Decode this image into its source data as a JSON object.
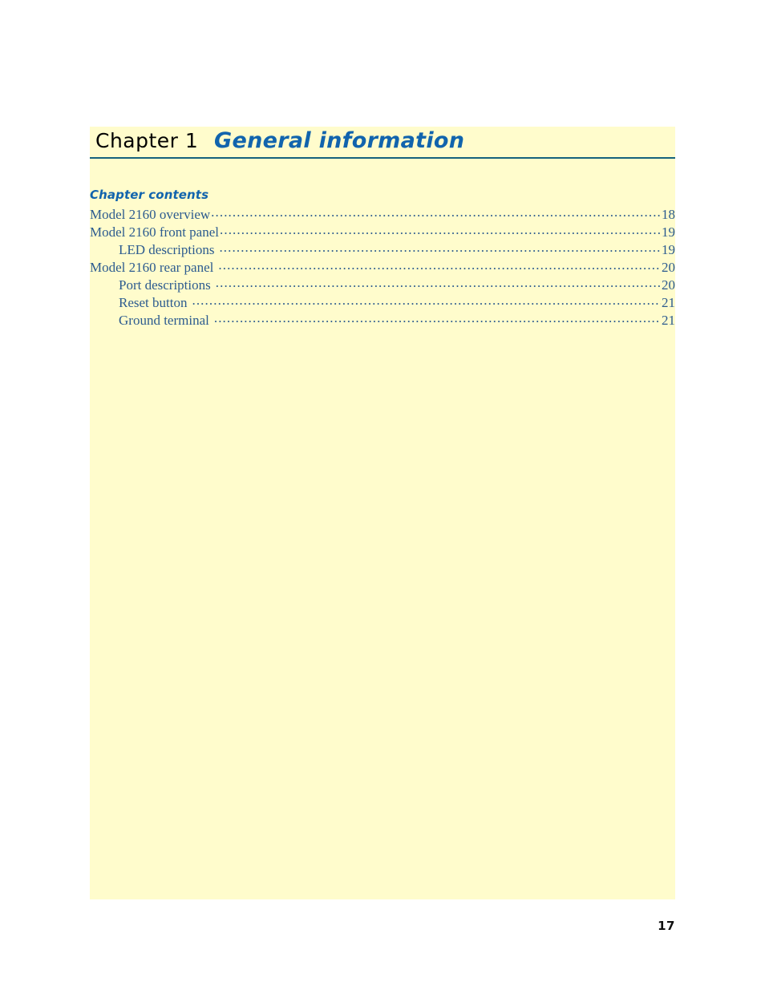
{
  "document": {
    "chapter_label": "Chapter 1",
    "chapter_heading": "General information",
    "contents_heading": "Chapter contents",
    "folio": "17"
  },
  "colors": {
    "page_background": "#ffffff",
    "content_background": "#fffccc",
    "heading_blue": "#1164ad",
    "toc_blue": "#2c5b8f",
    "rule_teal": "#16627d",
    "folio_black": "#111111"
  },
  "toc": {
    "entries": [
      {
        "label": "Model 2160 overview",
        "page": "18",
        "level": 0,
        "gap": false
      },
      {
        "label": "Model 2160 front panel",
        "page": "19",
        "level": 0,
        "gap": false
      },
      {
        "label": "LED descriptions",
        "page": "19",
        "level": 1,
        "gap": true
      },
      {
        "label": "Model 2160 rear panel",
        "page": "20",
        "level": 0,
        "gap": true
      },
      {
        "label": "Port descriptions",
        "page": "20",
        "level": 1,
        "gap": true
      },
      {
        "label": "Reset button",
        "page": "21",
        "level": 1,
        "gap": true
      },
      {
        "label": "Ground terminal",
        "page": "21",
        "level": 1,
        "gap": true
      }
    ]
  }
}
